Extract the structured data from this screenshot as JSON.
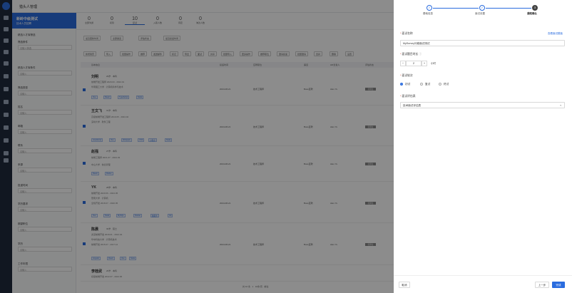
{
  "app": {
    "title": "猎头人管理"
  },
  "left_panel": {
    "job_title": "新岭中级测试",
    "job_sub": "技术人员招聘",
    "section": "精选人才库筛选",
    "filters": [
      {
        "label": "筛选条件",
        "placeholder": "请输入筛选"
      },
      {
        "label": "精选人才库条件",
        "placeholder": "请输入"
      },
      {
        "label": "筛选类型",
        "placeholder": "请输入"
      },
      {
        "label": "姓名",
        "placeholder": "请输入"
      },
      {
        "label": "邮箱",
        "placeholder": "请输入"
      },
      {
        "label": "联系",
        "placeholder": "请输入"
      },
      {
        "label": "来源",
        "placeholder": "请输入"
      },
      {
        "label": "投递时间",
        "placeholder": "请输入"
      },
      {
        "label": "学历要求",
        "placeholder": "请输入"
      },
      {
        "label": "期望职位",
        "placeholder": "请输入"
      },
      {
        "label": "学历",
        "placeholder": "请输入"
      },
      {
        "label": "工作年限",
        "placeholder": "请输入"
      }
    ],
    "reset": "重置",
    "search": "搜索"
  },
  "stats": [
    {
      "n": "0",
      "l": "全部沟通"
    },
    {
      "n": "0",
      "l": "初筛"
    },
    {
      "n": "10",
      "l": "复试"
    },
    {
      "n": "0",
      "l": "入职人数"
    },
    {
      "n": "0",
      "l": "待定"
    },
    {
      "n": "0",
      "l": "淘汰人数"
    }
  ],
  "filter_chips": [
    "最近更新时间",
    "全部渠道",
    "评估状态",
    "最近投递时间"
  ],
  "toolbar": [
    "新增简历",
    "导入",
    "批量操作",
    "推荐",
    "发送邮件",
    "标记",
    "导出",
    "面试",
    "共享",
    "批量导入",
    "更多操作",
    "推荐职位",
    "邀请投递",
    "批量邀请",
    "合并",
    "删除",
    "设置"
  ],
  "table": {
    "headers": [
      "基本信息",
      "投递时间",
      "应聘职位",
      "渠道",
      "HR负责人",
      "评估状态"
    ],
    "rows": [
      {
        "name": "刘明",
        "meta": "29岁 · 本科",
        "lines": [
          "前端开发工程师 2020.03 - 2024.01",
          "华南理工大学 · 计算机科学与技术"
        ],
        "date": "2024-08-21",
        "job": "技术工程师",
        "src": "Boss直聘",
        "hr": "Alex Yu",
        "status": "待评估",
        "tags": [
          "Vue",
          "React",
          "TypeScript",
          "Node"
        ]
      },
      {
        "name": "王文飞",
        "meta": "31岁 · 本科",
        "lines": [
          "高级前端开发工程师 2019.05 - 2024.02",
          "深圳大学 · 软件工程"
        ],
        "date": "2024-08-21",
        "job": "技术工程师",
        "src": "Boss直聘",
        "hr": "Alex Yu",
        "status": "待评估",
        "tags": [
          "JavaScript",
          "Vue",
          "Webpack",
          "CSS",
          "小程序",
          "Node"
        ]
      },
      {
        "name": "赵强",
        "meta": "27岁 · 本科",
        "lines": [
          "前端工程师 2021.07 - 2024.03",
          "中山大学 · 信息管理"
        ],
        "date": "2024-08-21",
        "job": "技术工程师",
        "src": "Boss直聘",
        "hr": "Alex Yu",
        "status": "待评估",
        "tags": [
          "React",
          "Redux"
        ]
      },
      {
        "name": "YK",
        "meta": "28岁 · 本科",
        "lines": [
          "前端开发 2020.06 - 2024.05",
          "暨南大学 · 计算机",
          "全栈开发 2018.07 - 2020.05"
        ],
        "date": "2024-08-21",
        "job": "技术工程师",
        "src": "Boss直聘",
        "hr": "Alex Yu",
        "status": "待评估",
        "tags": [
          "Vue",
          "Node",
          "MySQL",
          "Docker",
          "微服务",
          "Git"
        ]
      },
      {
        "name": "陈晨",
        "meta": "30岁 · 硕士",
        "lines": [
          "资深前端开发 2018.01 - 2024.04",
          "华中科技大学 · 计算机技术",
          "前端开发 2015.07 - 2017.12"
        ],
        "date": "2024-08-21",
        "job": "技术工程师",
        "src": "Boss直聘",
        "hr": "Alex Yu",
        "status": "待评估",
        "tags": [
          "Angular",
          "React",
          "Vue",
          "Node"
        ]
      },
      {
        "name": "李桂武",
        "meta": "26岁 · 本科",
        "lines": [
          "初级前端开发 2022.07 - 2024.06"
        ],
        "date": "",
        "job": "",
        "src": "",
        "hr": "",
        "status": "",
        "tags": []
      }
    ]
  },
  "pager": {
    "total": "共 10 条",
    "page": "1",
    "size": "10条/页",
    "goto": "前往"
  },
  "drawer": {
    "steps": [
      {
        "label": "基础信息",
        "icon": "check-icon"
      },
      {
        "label": "面试设置",
        "icon": "check-icon"
      },
      {
        "label": "通知确认",
        "n": "3"
      }
    ],
    "name_label": "面试名称",
    "name_link": "查看面试模板",
    "name_value": "MySurvey问卷面试测试",
    "duration_label": "面试题目时长",
    "duration_value": "2",
    "duration_unit": "小时",
    "round_label": "面试轮次",
    "round_options": [
      "初试",
      "复试",
      "终试"
    ],
    "round_selected": 0,
    "result_label": "面试评估表",
    "result_value": "技术面试评估表",
    "cancel": "取消",
    "prev": "上一步",
    "ok": "完成"
  },
  "colors": {
    "accent": "#2a6cdf",
    "nav": "#1f2a3d"
  }
}
